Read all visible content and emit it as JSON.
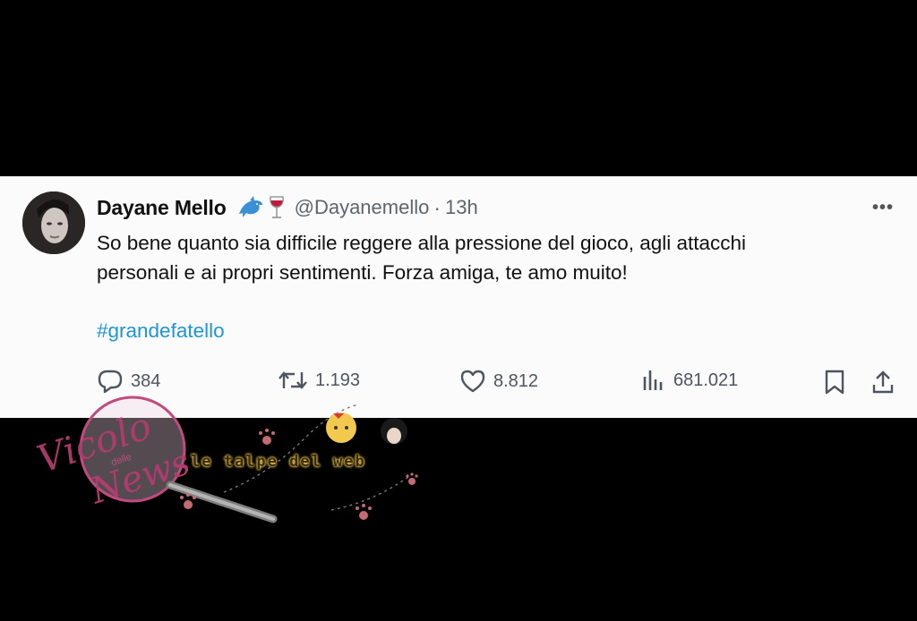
{
  "tweet": {
    "display_name": "Dayane Mello",
    "emoji": [
      "dolphin-emoji",
      "wine-glass-emoji"
    ],
    "handle": "@Dayanemello",
    "separator": "·",
    "time": "13h",
    "more": "•••",
    "text_line1": "So bene quanto sia difficile reggere alla pressione del gioco, agli attacchi",
    "text_line2": "personali e  ai propri sentimenti. Forza amiga, te amo muito!",
    "hashtag": "#grandefatello"
  },
  "actions": {
    "replies": "384",
    "retweets": "1.193",
    "likes": "8.812",
    "views": "681.021"
  },
  "watermark": {
    "talpe": "le talpe del web",
    "vicolo": "Vicolo",
    "delle": "delle",
    "news": "News"
  },
  "colors": {
    "card_bg": "#fbfbfb",
    "hashtag": "#1c96d8",
    "secondary_text": "#5b6670",
    "watermark_pink": "#b03c6e"
  }
}
